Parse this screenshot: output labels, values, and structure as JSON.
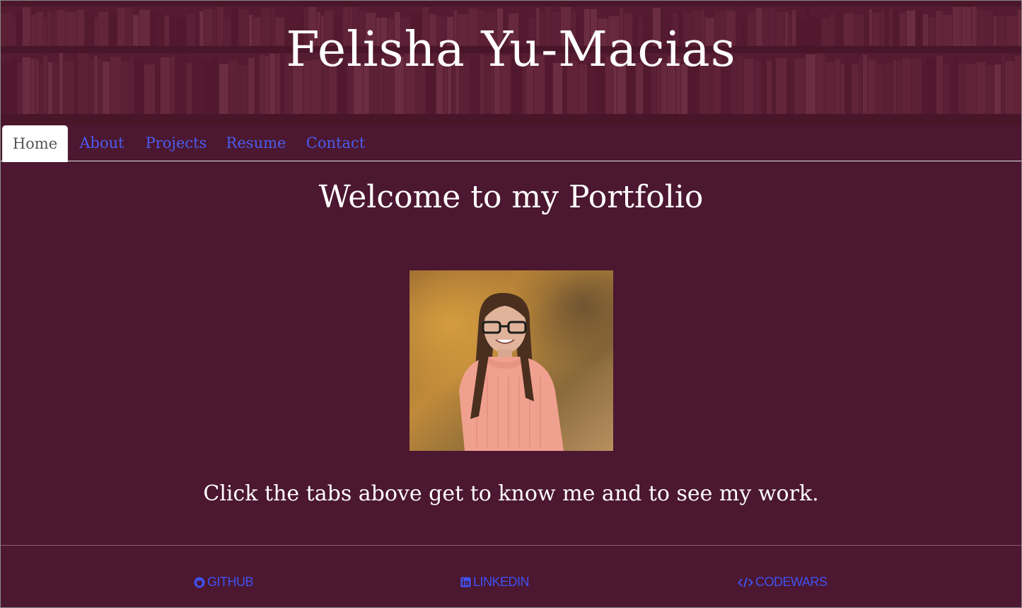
{
  "header": {
    "title": "Felisha Yu-Macias"
  },
  "nav": {
    "tabs": [
      {
        "label": "Home",
        "active": true
      },
      {
        "label": "About",
        "active": false
      },
      {
        "label": "Projects",
        "active": false
      },
      {
        "label": "Resume",
        "active": false
      },
      {
        "label": "Contact",
        "active": false
      }
    ]
  },
  "main": {
    "heading": "Welcome to my Portfolio",
    "tagline": "Click the tabs above get to know me and to see my work."
  },
  "footer": {
    "links": [
      {
        "label": "GITHUB",
        "icon": "github-icon"
      },
      {
        "label": "LINKEDIN",
        "icon": "linkedin-icon"
      },
      {
        "label": "CODEWARS",
        "icon": "code-icon"
      }
    ]
  },
  "colors": {
    "background": "#4c1730",
    "link": "#4a5cf0",
    "text": "#ffffff"
  }
}
